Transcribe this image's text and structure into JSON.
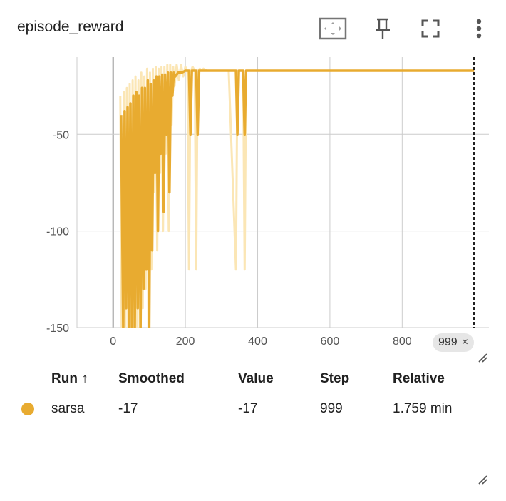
{
  "header": {
    "title": "episode_reward",
    "icons": [
      "fit-domain-icon",
      "pin-icon",
      "fullscreen-icon",
      "more-vert-icon"
    ]
  },
  "colors": {
    "series": "#e8ab30",
    "series_raw": "#fbe6b5",
    "grid": "#cccccc",
    "axis": "#999999",
    "cursor": "#212121"
  },
  "chart_data": {
    "type": "line",
    "xlim": [
      -100,
      1040
    ],
    "ylim": [
      -150,
      -10
    ],
    "x_ticks": [
      0,
      200,
      400,
      600,
      800
    ],
    "y_ticks": [
      -50,
      -100,
      -150
    ],
    "x_tick_labels": [
      "0",
      "200",
      "400",
      "600",
      "800"
    ],
    "y_tick_labels": [
      "-50",
      "-100",
      "-150"
    ],
    "grid": true,
    "cursor_step": 999,
    "series": [
      {
        "name": "sarsa",
        "raw": {
          "x": [
            20,
            24,
            30,
            34,
            38,
            42,
            46,
            50,
            54,
            58,
            62,
            66,
            70,
            74,
            78,
            82,
            86,
            90,
            94,
            98,
            102,
            106,
            110,
            114,
            118,
            122,
            126,
            130,
            134,
            138,
            142,
            146,
            150,
            154,
            158,
            162,
            166,
            170,
            176,
            182,
            188,
            194,
            200,
            206,
            210,
            214,
            220,
            226,
            230,
            234,
            240,
            246,
            250,
            260,
            280,
            300,
            320,
            340,
            344,
            348,
            352,
            360,
            364,
            368,
            380,
            400,
            440,
            500,
            560,
            600,
            700,
            800,
            900,
            999
          ],
          "y": [
            -30,
            -160,
            -28,
            -150,
            -26,
            -160,
            -24,
            -160,
            -22,
            -160,
            -20,
            -150,
            -22,
            -160,
            -18,
            -140,
            -20,
            -130,
            -16,
            -160,
            -18,
            -120,
            -16,
            -80,
            -15,
            -110,
            -16,
            -70,
            -15,
            -100,
            -15,
            -60,
            -14,
            -100,
            -14,
            -45,
            -15,
            -25,
            -14,
            -22,
            -14,
            -20,
            -15,
            -18,
            -120,
            -18,
            -15,
            -17,
            -120,
            -17,
            -16,
            -17,
            -16,
            -17,
            -17,
            -17,
            -17,
            -120,
            -17,
            -17,
            -17,
            -17,
            -120,
            -17,
            -17,
            -17,
            -17,
            -17,
            -17,
            -17,
            -17,
            -17,
            -17,
            -17
          ]
        },
        "smoothed": {
          "x": [
            22,
            28,
            32,
            36,
            40,
            44,
            48,
            52,
            56,
            60,
            64,
            68,
            72,
            76,
            80,
            84,
            88,
            92,
            96,
            100,
            104,
            108,
            112,
            116,
            120,
            124,
            128,
            132,
            136,
            140,
            144,
            148,
            152,
            156,
            160,
            164,
            168,
            172,
            180,
            190,
            200,
            210,
            214,
            218,
            222,
            226,
            230,
            234,
            238,
            242,
            246,
            250,
            260,
            280,
            300,
            320,
            340,
            344,
            348,
            352,
            356,
            360,
            364,
            368,
            380,
            400,
            440,
            500,
            560,
            600,
            700,
            800,
            900,
            999
          ],
          "y": [
            -40,
            -150,
            -38,
            -140,
            -36,
            -150,
            -34,
            -150,
            -30,
            -150,
            -28,
            -140,
            -30,
            -150,
            -26,
            -130,
            -26,
            -120,
            -22,
            -150,
            -24,
            -110,
            -22,
            -70,
            -20,
            -100,
            -20,
            -60,
            -19,
            -90,
            -19,
            -50,
            -18,
            -80,
            -18,
            -30,
            -18,
            -20,
            -18,
            -18,
            -17,
            -17,
            -50,
            -17,
            -17,
            -17,
            -17,
            -50,
            -17,
            -17,
            -17,
            -17,
            -17,
            -17,
            -17,
            -17,
            -17,
            -50,
            -17,
            -17,
            -17,
            -17,
            -50,
            -17,
            -17,
            -17,
            -17,
            -17,
            -17,
            -17,
            -17,
            -17,
            -17,
            -17
          ]
        }
      }
    ]
  },
  "step_chip": {
    "label": "999",
    "close": "×"
  },
  "table": {
    "headers": {
      "run": "Run ↑",
      "smoothed": "Smoothed",
      "value": "Value",
      "step": "Step",
      "relative": "Relative"
    },
    "rows": [
      {
        "run": "sarsa",
        "smoothed": "-17",
        "value": "-17",
        "step": "999",
        "relative": "1.759 min"
      }
    ]
  }
}
